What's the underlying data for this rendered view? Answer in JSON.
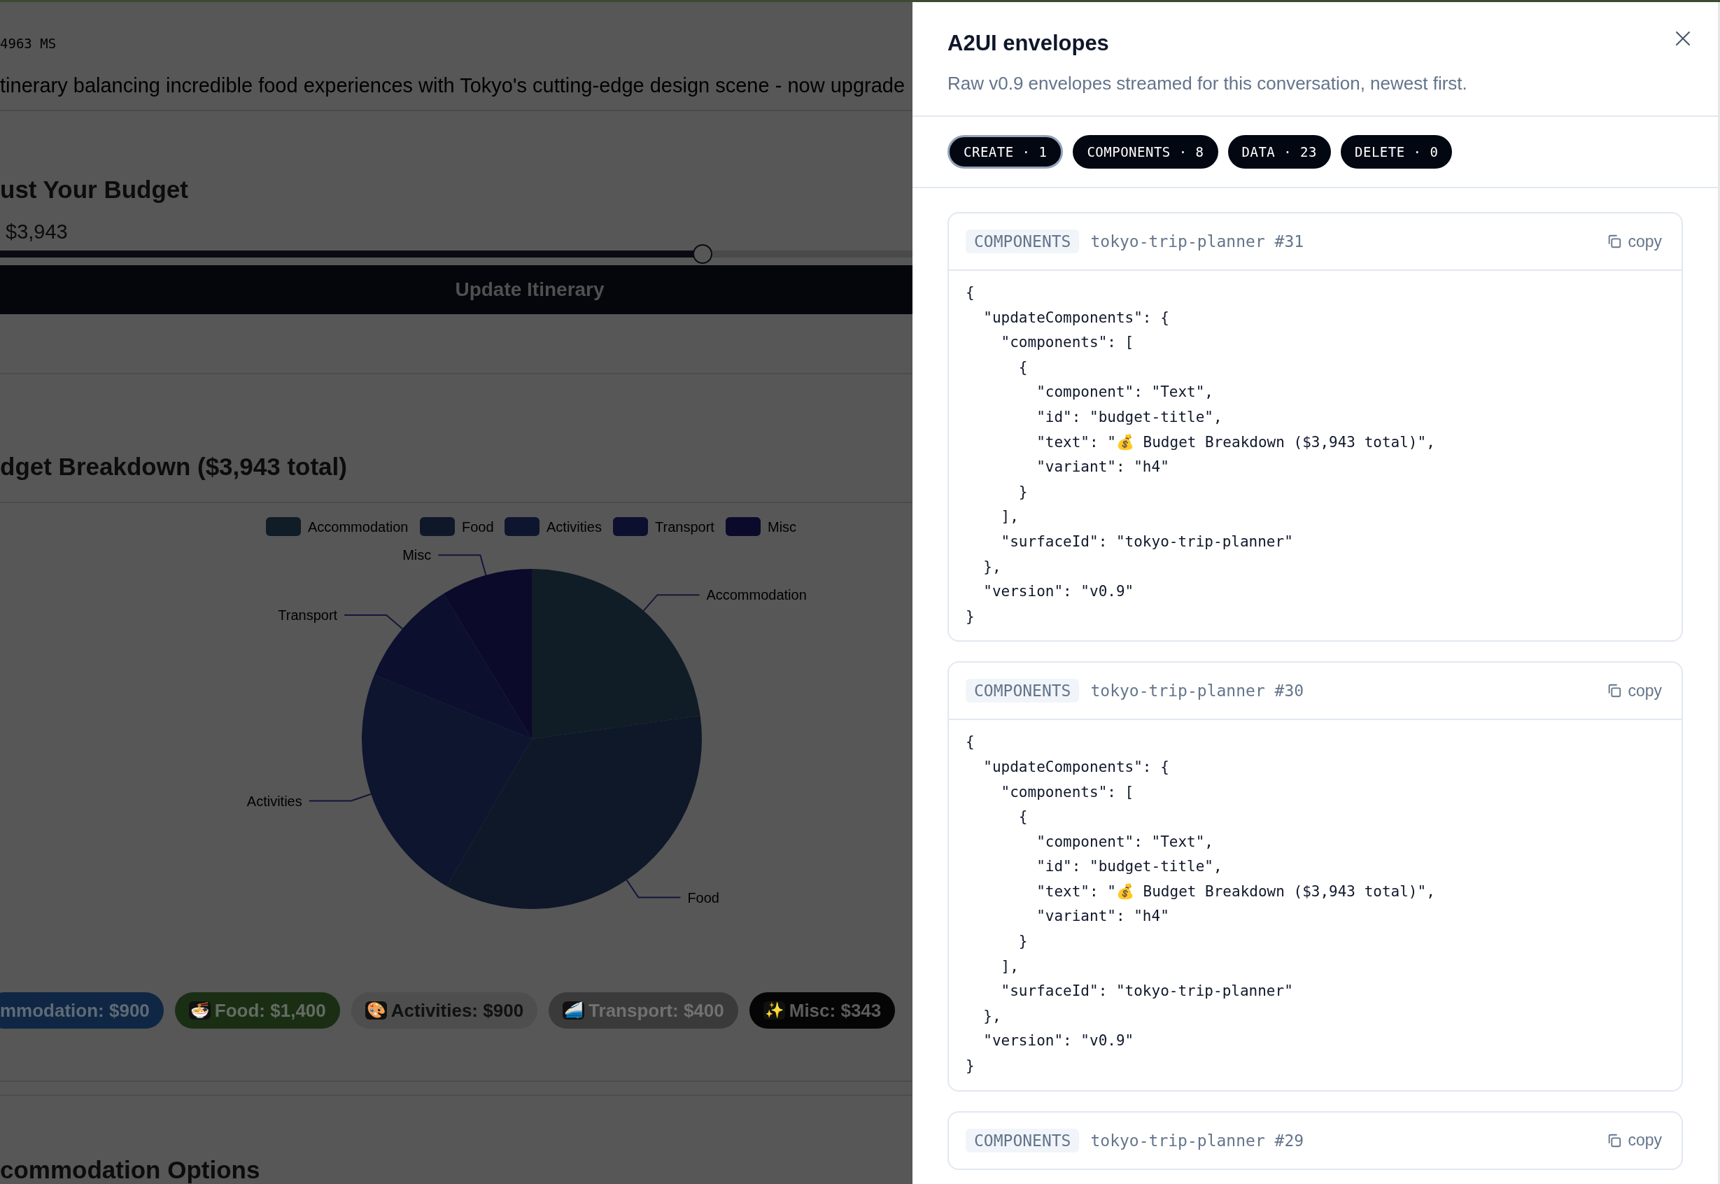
{
  "backdrop": {
    "timing": "4963 MS",
    "summary": "tinerary balancing incredible food experiences with Tokyo's cutting-edge design scene - now upgrade",
    "budget": {
      "heading": "ust Your Budget",
      "amount": "$3,943",
      "slider": {
        "level": 0.77
      },
      "button": "Update Itinerary"
    },
    "breakdown": {
      "heading": "dget Breakdown ($3,943 total)",
      "legend": [
        {
          "label": "Accommodation",
          "color": "#101c26"
        },
        {
          "label": "Food",
          "color": "#0f1829"
        },
        {
          "label": "Activities",
          "color": "#0e152e"
        },
        {
          "label": "Transport",
          "color": "#0c0f2e"
        },
        {
          "label": "Misc",
          "color": "#0b0a2b"
        }
      ],
      "chart_data": {
        "type": "pie",
        "categories": [
          "Accommodation",
          "Food",
          "Activities",
          "Transport",
          "Misc"
        ],
        "values": [
          22.82,
          35.51,
          22.83,
          10.14,
          8.7
        ]
      },
      "chips": [
        {
          "label": "mmodation: $900",
          "color": "#0f2744"
        },
        {
          "icon": "🍜",
          "label": "Food: $1,400",
          "color": "#1a2e14"
        },
        {
          "icon": "🎨",
          "label": "Activities: $900",
          "color": "#4e4e4e"
        },
        {
          "icon": "🚄",
          "label": "Transport: $400",
          "color": "#3a3a3a"
        },
        {
          "icon": "✨",
          "label": "Misc: $343",
          "color": "#050505"
        }
      ]
    },
    "next_heading": "commodation Options"
  },
  "panel": {
    "title": "A2UI envelopes",
    "subtitle": "Raw v0.9 envelopes streamed for this conversation, newest first.",
    "filters": [
      {
        "label": "CREATE · 1",
        "selected": true
      },
      {
        "label": "COMPONENTS · 8",
        "selected": false
      },
      {
        "label": "DATA · 23",
        "selected": false
      },
      {
        "label": "DELETE · 0",
        "selected": false
      }
    ],
    "envelopes": [
      {
        "tag": "COMPONENTS",
        "name": "tokyo-trip-planner #31",
        "copy": "copy",
        "code": [
          "{",
          "  \"updateComponents\": {",
          "    \"components\": [",
          "      {",
          "        \"component\": \"Text\",",
          "        \"id\": \"budget-title\",",
          "        \"text\": \"💰 Budget Breakdown ($3,943 total)\",",
          "        \"variant\": \"h4\"",
          "      }",
          "    ],",
          "    \"surfaceId\": \"tokyo-trip-planner\"",
          "  },",
          "  \"version\": \"v0.9\"",
          "}"
        ]
      },
      {
        "tag": "COMPONENTS",
        "name": "tokyo-trip-planner #30",
        "copy": "copy",
        "code": [
          "{",
          "  \"updateComponents\": {",
          "    \"components\": [",
          "      {",
          "        \"component\": \"Text\",",
          "        \"id\": \"budget-title\",",
          "        \"text\": \"💰 Budget Breakdown ($3,943 total)\",",
          "        \"variant\": \"h4\"",
          "      }",
          "    ],",
          "    \"surfaceId\": \"tokyo-trip-planner\"",
          "  },",
          "  \"version\": \"v0.9\"",
          "}"
        ]
      },
      {
        "tag": "COMPONENTS",
        "name": "tokyo-trip-planner #29",
        "copy": "copy"
      }
    ]
  }
}
